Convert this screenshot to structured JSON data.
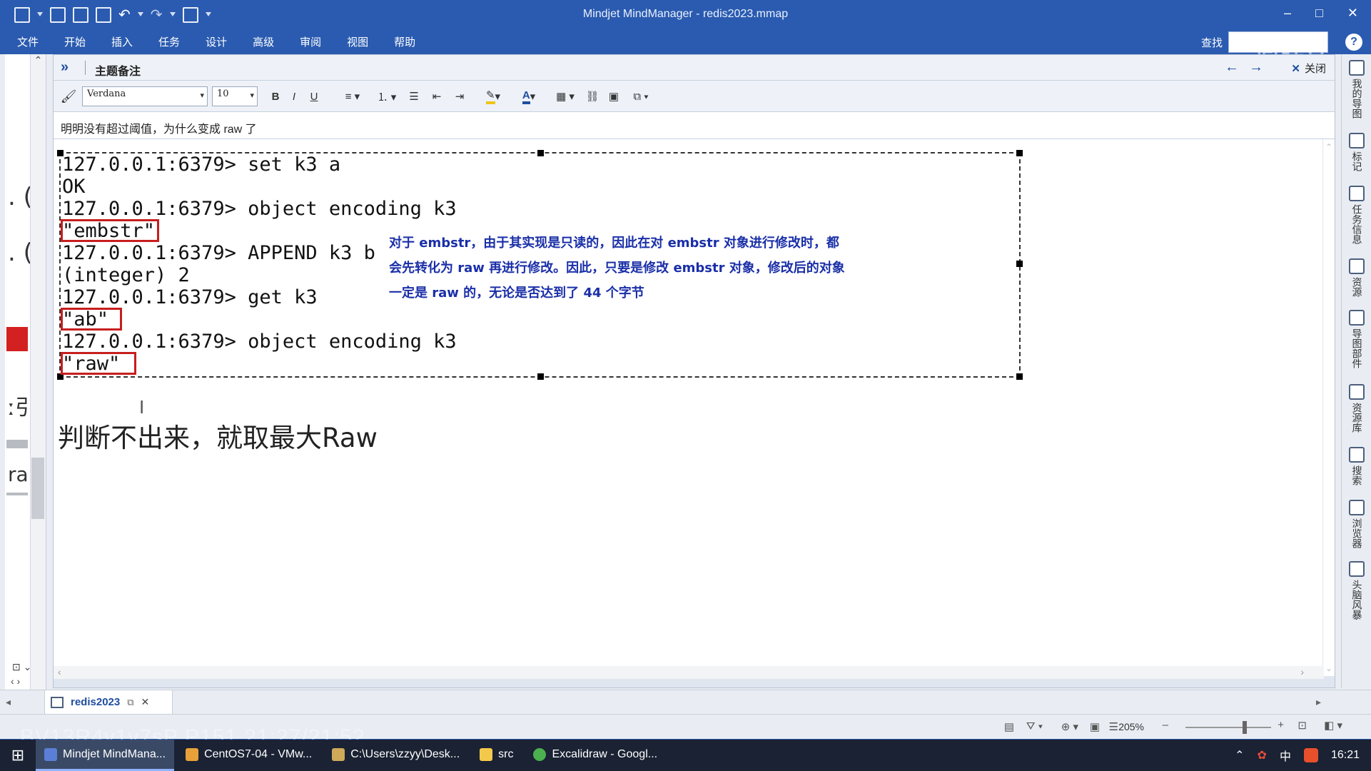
{
  "window": {
    "title": "Mindjet MindManager - redis2023.mmap",
    "minimize": "–",
    "maximize": "□",
    "close": "✕"
  },
  "menu": [
    "文件",
    "开始",
    "插入",
    "任务",
    "设计",
    "高级",
    "审阅",
    "视图",
    "帮助"
  ],
  "search": {
    "label": "查找"
  },
  "help": "?",
  "notes": {
    "header_arrows": "»",
    "title": "主题备注",
    "close_label": "关闭",
    "font": "Verdana",
    "size": "10",
    "subject": "明明没有超过阈值，为什么变成 raw 了",
    "terminal_lines": [
      "127.0.0.1:6379> set k3 a",
      "OK",
      "127.0.0.1:6379> object encoding k3",
      "\"embstr\"",
      "127.0.0.1:6379> APPEND k3 b",
      "(integer) 2",
      "127.0.0.1:6379> get k3",
      "\"ab\"",
      "127.0.0.1:6379> object encoding k3",
      "\"raw\""
    ],
    "explanation": [
      "对于 embstr，由于其实现是只读的，因此在对 embstr 对象进行修改时，都",
      "会先转化为 raw 再进行修改。因此，只要是修改 embstr 对象，修改后的对象",
      "一定是 raw 的，无论是否达到了 44 个字节"
    ],
    "conclusion": "判断不出来，就取最大Raw"
  },
  "left_fragments": {
    "f1": ". (",
    "f2": ". (",
    "f3": "ː引",
    "f4": "ra"
  },
  "dock": [
    {
      "label": "我的导图"
    },
    {
      "label": "标记"
    },
    {
      "label": "任务信息"
    },
    {
      "label": "资源"
    },
    {
      "label": "导图部件"
    },
    {
      "label": "资源库"
    },
    {
      "label": "搜索"
    },
    {
      "label": "浏览器"
    },
    {
      "label": "头脑风暴"
    }
  ],
  "doc_tab": {
    "label": "redis2023"
  },
  "status": {
    "zoom": "205%"
  },
  "watermark": {
    "bottom": "BV13R4y1v7sP P151 21:27/21:52",
    "top": "尚硅谷"
  },
  "taskbar": {
    "tasks": [
      {
        "label": "Mindjet MindMana...",
        "color": "#5b7fd6"
      },
      {
        "label": "CentOS7-04 - VMw...",
        "color": "#e8a13a"
      },
      {
        "label": "C:\\Users\\zzyy\\Desk...",
        "color": "#cfa95a"
      },
      {
        "label": "src",
        "color": "#f3c94b"
      },
      {
        "label": "Excalidraw - Googl...",
        "color": "#4caf50"
      }
    ],
    "ime": "中",
    "time": "16:21"
  }
}
